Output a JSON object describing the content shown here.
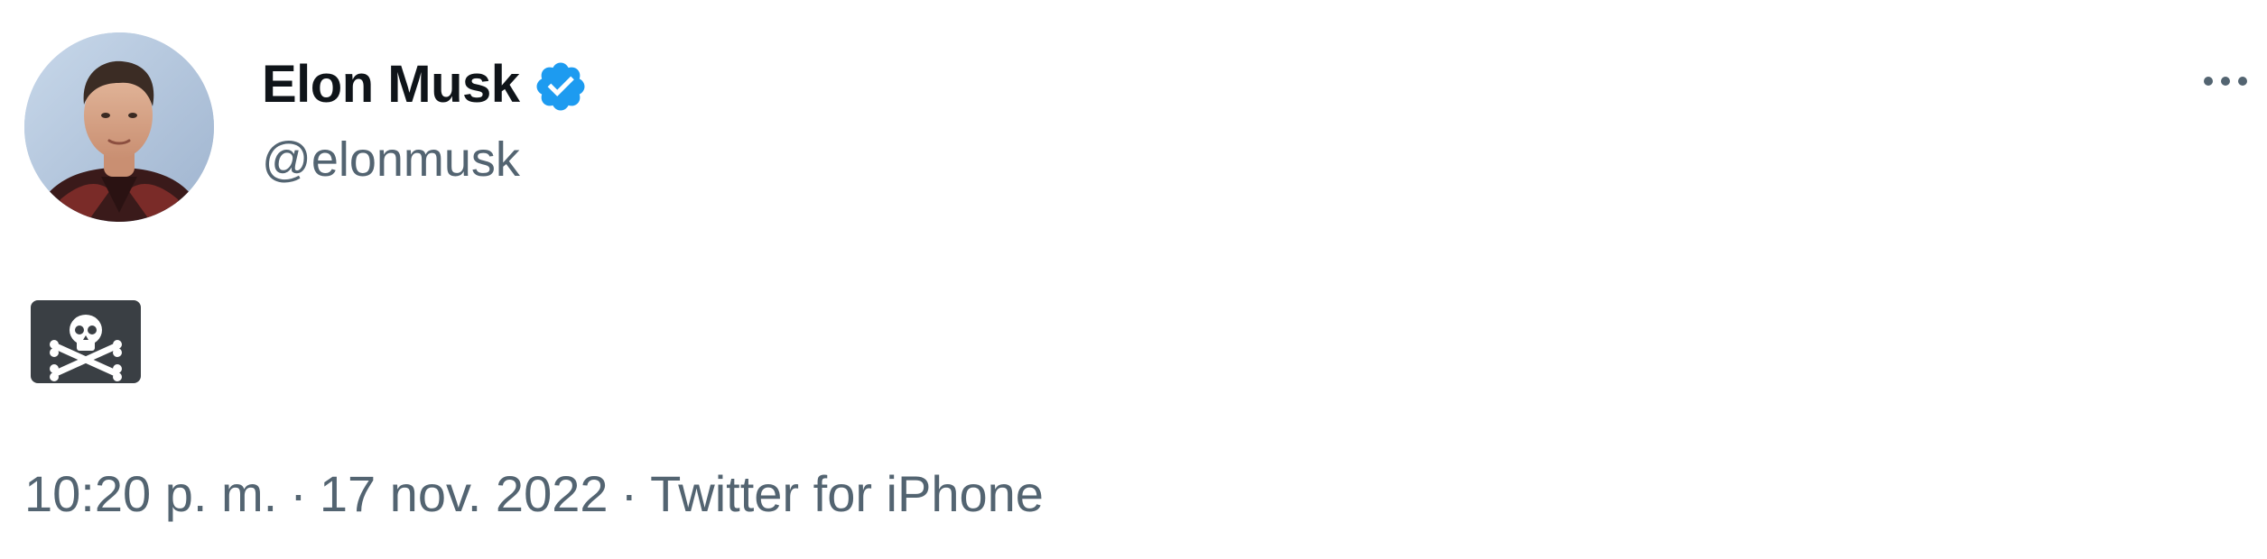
{
  "tweet": {
    "author": {
      "display_name": "Elon Musk",
      "handle": "@elonmusk",
      "verified": true,
      "avatar_icon": "profile-photo"
    },
    "body": {
      "emoji": "🏴‍☠️",
      "emoji_icon": "pirate-flag-icon"
    },
    "meta": {
      "time": "10:20 p. m.",
      "separator": "·",
      "date": "17 nov. 2022",
      "source": "Twitter for iPhone"
    },
    "more_icon": "more-horizontal-icon"
  },
  "colors": {
    "text_primary": "#0f1419",
    "text_secondary": "#536471",
    "verified_blue": "#1d9bf0",
    "background": "#ffffff"
  }
}
